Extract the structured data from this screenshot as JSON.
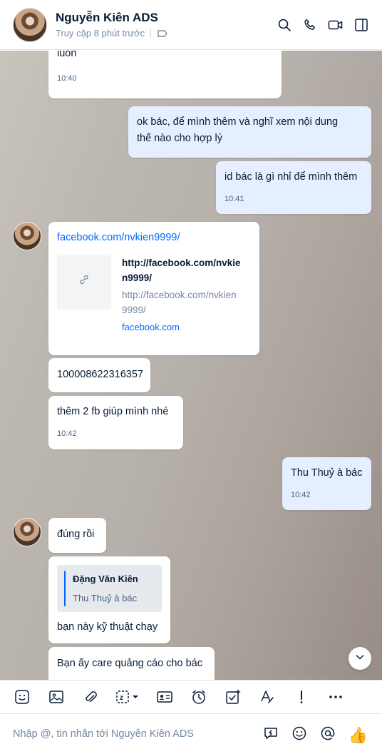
{
  "header": {
    "name": "Nguyễn Kiên ADS",
    "status": "Truy cập 8 phút trước"
  },
  "messages": {
    "m1": {
      "text": "luôn",
      "time": "10:40"
    },
    "m2": {
      "line1": "ok bác, để mình thêm và nghĩ xem nội dung",
      "line2": "thế nào cho hợp lý"
    },
    "m3": {
      "text": "id bác là gì nhỉ để mình thêm",
      "time": "10:41"
    },
    "m4": {
      "link": "facebook.com/nvkien9999/",
      "preview_title_1": "http://facebook.com/nvkie",
      "preview_title_2": "n9999/",
      "preview_url_1": "http://facebook.com/nvkien",
      "preview_url_2": "9999/",
      "preview_domain": "facebook.com"
    },
    "m5": {
      "text": "100008622316357"
    },
    "m6": {
      "text": "thêm 2 fb giúp mình nhé",
      "time": "10:42"
    },
    "m7": {
      "text": "Thu Thuỷ à bác",
      "time": "10:42"
    },
    "m8": {
      "text": "đúng rồi"
    },
    "m9": {
      "quote_author": "Đặng Văn Kiên",
      "quote_text": "Thu Thuỷ à bác",
      "text": "bạn này kỹ thuật chạy"
    },
    "m10": {
      "text": "Bạn ấy care quảng cáo cho bác"
    }
  },
  "composer": {
    "placeholder": "Nhập @, tin nhắn tới Nguyễn Kiên ADS"
  },
  "icons": {
    "header": [
      "search-icon",
      "phone-icon",
      "video-icon",
      "sidebar-toggle-icon"
    ],
    "toolbar": [
      "sticker-icon",
      "image-icon",
      "attach-icon",
      "screenshot-icon",
      "contact-card-icon",
      "reminder-icon",
      "task-icon",
      "format-text-icon",
      "urgent-icon",
      "more-icon"
    ]
  },
  "colors": {
    "accent": "#0068ff",
    "my_bubble": "#e5efff"
  }
}
